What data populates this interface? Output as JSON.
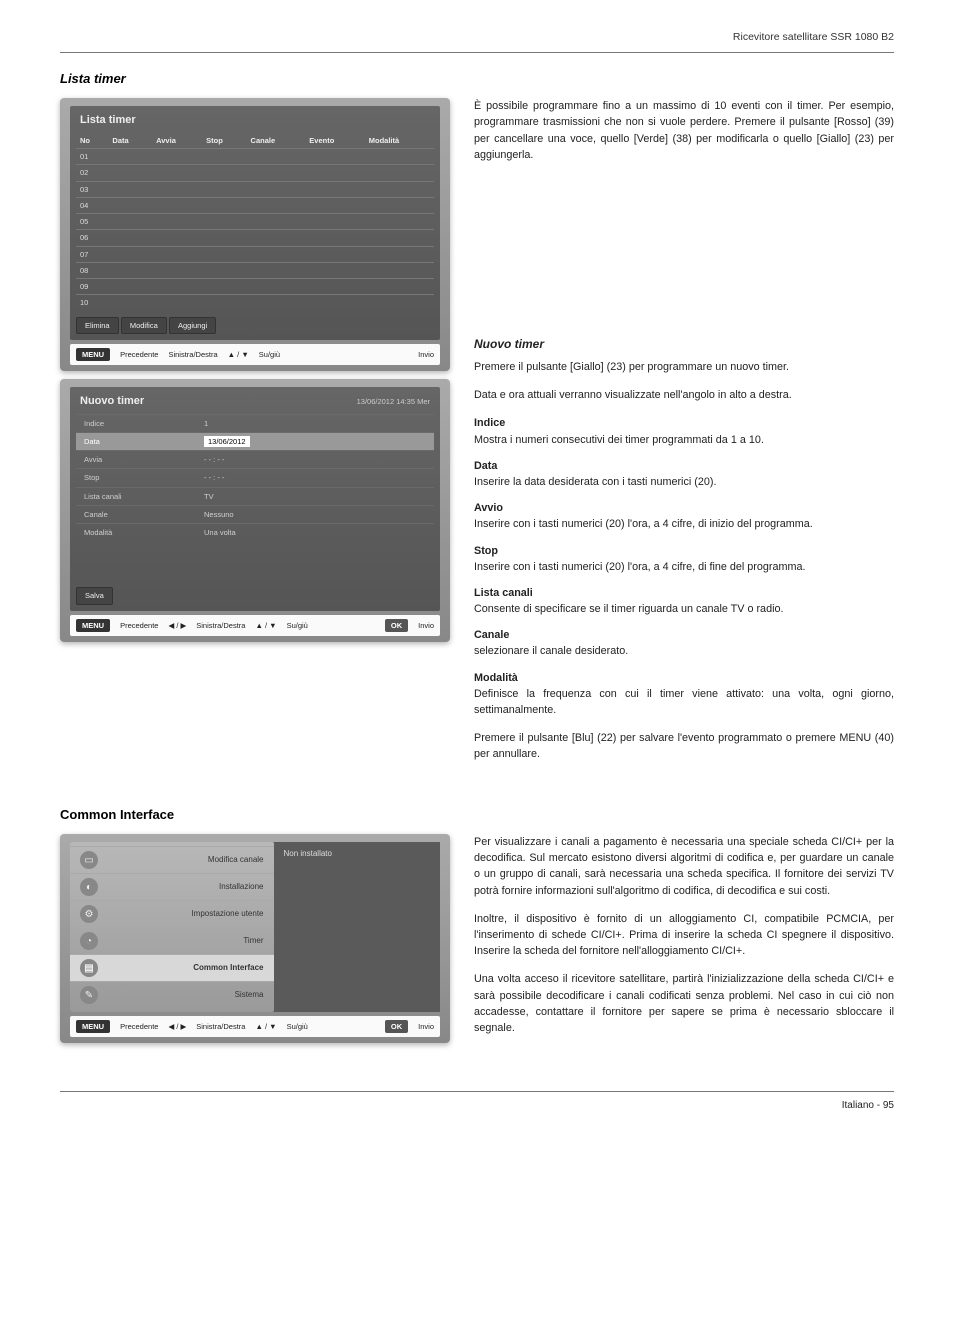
{
  "header": {
    "product": "Ricevitore satellitare SSR 1080 B2"
  },
  "section1": {
    "title": "Lista timer",
    "screenshot1": {
      "title": "Lista timer",
      "columns": [
        "No",
        "Data",
        "Avvia",
        "Stop",
        "Canale",
        "Evento",
        "Modalità"
      ],
      "rows": [
        "01",
        "02",
        "03",
        "04",
        "05",
        "06",
        "07",
        "08",
        "09",
        "10"
      ],
      "buttons": [
        "Elimina",
        "Modifica",
        "Aggiungi"
      ],
      "footer": {
        "menu": "MENU",
        "prev": "Precedente",
        "lr": "Sinistra/Destra",
        "ud": "Su/giù",
        "enter": "Invio"
      }
    },
    "intro": "È possibile programmare fino a un massimo di 10 eventi con il timer. Per esempio, programmare trasmissioni che non si vuole perdere. Premere il pulsante [Rosso] (39) per cancellare una voce, quello [Verde] (38) per modificarla o quello [Giallo] (23) per aggiungerla.",
    "screenshot2": {
      "title": "Nuovo timer",
      "timestamp": "13/06/2012 14:35 Mer",
      "rows": [
        {
          "label": "Indice",
          "value": "1"
        },
        {
          "label": "Data",
          "value": "13/06/2012",
          "selected": true
        },
        {
          "label": "Avvia",
          "value": "- - : - -"
        },
        {
          "label": "Stop",
          "value": "- - : - -"
        },
        {
          "label": "Lista canali",
          "value": "TV"
        },
        {
          "label": "Canale",
          "value": "Nessuno"
        },
        {
          "label": "Modalità",
          "value": "Una volta"
        }
      ],
      "save": "Salva",
      "footer": {
        "menu": "MENU",
        "prev": "Precedente",
        "lr": "Sinistra/Destra",
        "ud": "Su/giù",
        "ok": "OK",
        "enter": "Invio"
      }
    },
    "nuovo": {
      "title": "Nuovo timer",
      "intro1": "Premere il pulsante [Giallo] (23) per programmare un nuovo timer.",
      "intro2": "Data e ora attuali verranno visualizzate nell'angolo in alto a destra.",
      "fields": [
        {
          "head": "Indice",
          "body": "Mostra i numeri consecutivi dei timer programmati da 1 a 10."
        },
        {
          "head": "Data",
          "body": "Inserire la data desiderata con i tasti numerici (20)."
        },
        {
          "head": "Avvio",
          "body": "Inserire con i tasti numerici (20) l'ora, a 4 cifre, di inizio del programma."
        },
        {
          "head": "Stop",
          "body": "Inserire con i tasti numerici (20) l'ora, a 4 cifre, di fine del programma."
        },
        {
          "head": "Lista canali",
          "body": "Consente di specificare se il timer riguarda un canale TV o radio."
        },
        {
          "head": "Canale",
          "body": "selezionare il canale desiderato."
        },
        {
          "head": "Modalità",
          "body": "Definisce la frequenza con cui il timer viene attivato: una volta, ogni giorno, settimanalmente."
        }
      ],
      "outro": "Premere il pulsante [Blu] (22) per salvare l'evento programmato o premere MENU (40) per annullare."
    }
  },
  "section2": {
    "title": "Common Interface",
    "screenshot": {
      "items": [
        {
          "label": "Modifica canale",
          "icon": "tv"
        },
        {
          "label": "Installazione",
          "icon": "sat"
        },
        {
          "label": "Impostazione utente",
          "icon": "gear"
        },
        {
          "label": "Timer",
          "icon": "clock"
        },
        {
          "label": "Common Interface",
          "icon": "card",
          "active": true
        },
        {
          "label": "Sistema",
          "icon": "wrench"
        }
      ],
      "right_pane": "Non installato",
      "footer": {
        "menu": "MENU",
        "prev": "Precedente",
        "lr": "Sinistra/Destra",
        "ud": "Su/giù",
        "ok": "OK",
        "enter": "Invio"
      }
    },
    "paragraphs": [
      "Per visualizzare i canali a pagamento è necessaria una speciale scheda CI/CI+ per la decodifica. Sul mercato esistono diversi algoritmi di codifica e,  per guardare un canale o un gruppo di canali, sarà necessaria una scheda specifica. Il fornitore dei servizi TV potrà fornire informazioni sull'algoritmo di codifica, di decodifica e sui costi.",
      "Inoltre, il dispositivo è fornito di un alloggiamento CI, compatibile PCMCIA, per l'inserimento di schede CI/CI+. Prima di inserire la scheda CI spegnere il dispositivo. Inserire la scheda del fornitore nell'alloggiamento CI/CI+.",
      "Una volta acceso il ricevitore satellitare, partirà l'inizializzazione della scheda CI/CI+ e sarà possibile decodificare i canali codificati senza problemi. Nel caso in cui ciò non accadesse, contattare il fornitore per sapere se prima è necessario sbloccare il segnale."
    ]
  },
  "footer": {
    "lang": "Italiano",
    "page": "95"
  }
}
